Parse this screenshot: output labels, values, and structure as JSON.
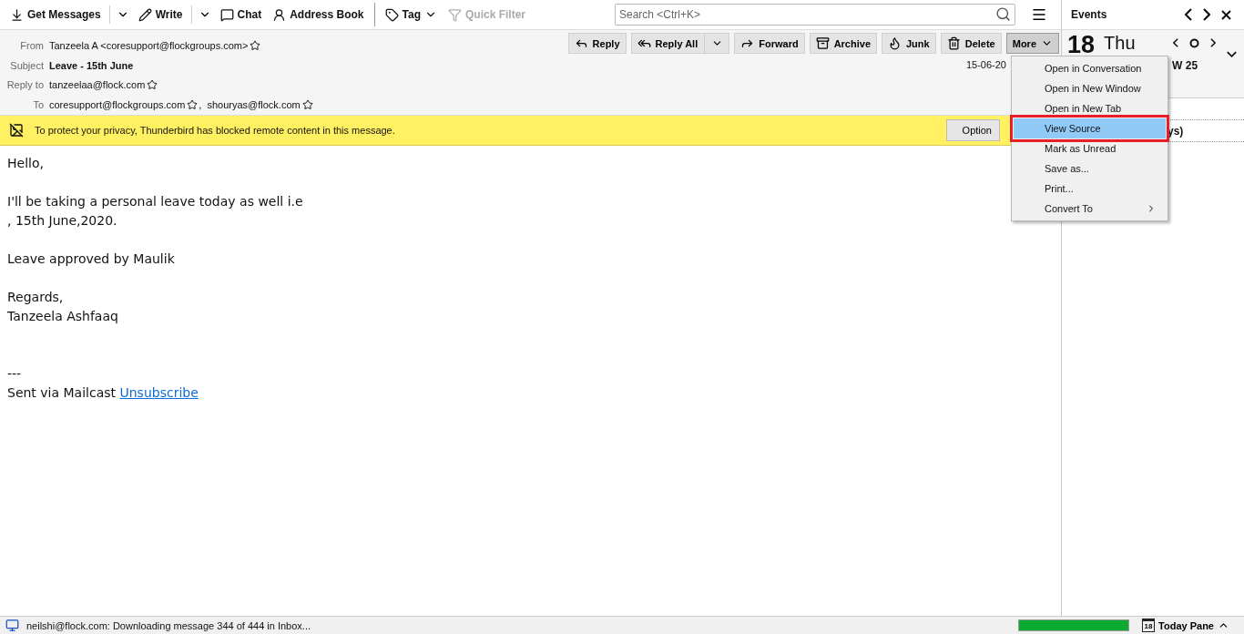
{
  "toolbar": {
    "items": [
      {
        "label": "Get Messages",
        "kind": "split",
        "disabled": false
      },
      {
        "label": "Write",
        "kind": "split",
        "disabled": false
      },
      {
        "label": "Chat",
        "kind": "plain",
        "disabled": false
      },
      {
        "label": "Address Book",
        "kind": "plain",
        "disabled": false
      },
      {
        "label": "Tag",
        "kind": "menu",
        "disabled": false
      },
      {
        "label": "Quick Filter",
        "kind": "plain",
        "disabled": true
      }
    ],
    "search": {
      "placeholder": "Search <Ctrl+K>"
    }
  },
  "header": {
    "fields": [
      {
        "label": "From",
        "kind": "contacts",
        "contacts": [
          "Tanzeela A <coresupport@flockgroups.com>"
        ]
      },
      {
        "label": "Subject",
        "kind": "subject",
        "value": "Leave - 15th June"
      },
      {
        "label": "Reply to",
        "kind": "contacts",
        "contacts": [
          "tanzeelaa@flock.com"
        ]
      },
      {
        "label": "To",
        "kind": "contacts",
        "contacts": [
          "coresupport@flockgroups.com",
          "shouryas@flock.com"
        ],
        "separator": ","
      }
    ],
    "buttons": [
      {
        "label": "Reply",
        "kind": "plain",
        "pressed": false
      },
      {
        "label": "Reply All",
        "kind": "split",
        "pressed": false
      },
      {
        "label": "Forward",
        "kind": "plain",
        "pressed": false
      },
      {
        "label": "Archive",
        "kind": "plain",
        "pressed": false
      },
      {
        "label": "Junk",
        "kind": "plain",
        "pressed": false
      },
      {
        "label": "Delete",
        "kind": "plain",
        "pressed": false
      },
      {
        "label": "More",
        "kind": "menu",
        "pressed": true
      }
    ],
    "date": "15-06-20"
  },
  "menu": {
    "items": [
      {
        "label": "Open in Conversation",
        "kind": "item",
        "selected": false
      },
      {
        "label": "Open in New Window",
        "kind": "item",
        "selected": false
      },
      {
        "label": "Open in New Tab",
        "kind": "item",
        "selected": false
      },
      {
        "label": "View Source",
        "kind": "item",
        "selected": true
      },
      {
        "label": "Mark as Unread",
        "kind": "item",
        "selected": false
      },
      {
        "label": "Save as...",
        "kind": "item",
        "selected": false
      },
      {
        "label": "Print...",
        "kind": "item",
        "selected": false
      },
      {
        "label": "Convert To",
        "kind": "submenu",
        "selected": false
      }
    ]
  },
  "notification": {
    "text": "To protect your privacy, Thunderbird has blocked remote content in this message.",
    "button": "Option"
  },
  "body": {
    "paragraphs": [
      {
        "lines": [
          "Hello,"
        ]
      },
      {
        "lines": [
          "I'll be taking a personal leave today as well i.e",
          ", 15th June,2020."
        ]
      },
      {
        "lines": [
          "Leave approved by Maulik"
        ]
      },
      {
        "lines": [
          "Regards,",
          "Tanzeela Ashfaaq"
        ]
      }
    ],
    "signature": {
      "separator": "---",
      "text": "Sent via Mailcast",
      "link": "Unsubscribe"
    }
  },
  "events": {
    "title": "Events",
    "day": "18",
    "weekday": "Thu",
    "week": "W 25",
    "fragment": "ys)"
  },
  "status_bar": {
    "text": "neilshi@flock.com: Downloading message 344 of 444 in Inbox...",
    "progress": {
      "level": 1.0
    },
    "today_icon_day": "18",
    "today_pane": "Today Pane"
  }
}
